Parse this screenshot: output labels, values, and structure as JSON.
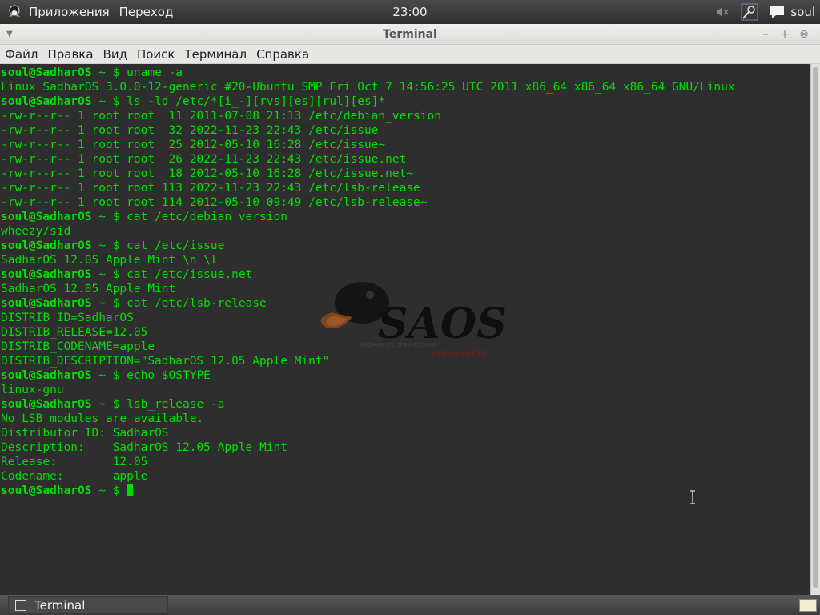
{
  "top_panel": {
    "menu_apps": "Приложения",
    "menu_places": "Переход",
    "clock": "23:00",
    "user": "soul"
  },
  "window": {
    "title": "Terminal",
    "buttons": {
      "minimize": "–",
      "maximize": "+",
      "close": "⊗"
    }
  },
  "menubar": [
    "Файл",
    "Правка",
    "Вид",
    "Поиск",
    "Терминал",
    "Справка"
  ],
  "terminal": {
    "prompt_user": "soul@SadharOS",
    "prompt_rest": " ~ $ ",
    "lines": [
      {
        "type": "cmd",
        "text": "uname -a"
      },
      {
        "type": "out",
        "text": "Linux SadharOS 3.0.0-12-generic #20-Ubuntu SMP Fri Oct 7 14:56:25 UTC 2011 x86_64 x86_64 x86_64 GNU/Linux"
      },
      {
        "type": "cmd",
        "text": "ls -ld /etc/*[i_-][rvs][es][rul][es]*"
      },
      {
        "type": "out",
        "text": "-rw-r--r-- 1 root root  11 2011-07-08 21:13 /etc/debian_version"
      },
      {
        "type": "out",
        "text": "-rw-r--r-- 1 root root  32 2022-11-23 22:43 /etc/issue"
      },
      {
        "type": "out",
        "text": "-rw-r--r-- 1 root root  25 2012-05-10 16:28 /etc/issue~"
      },
      {
        "type": "out",
        "text": "-rw-r--r-- 1 root root  26 2022-11-23 22:43 /etc/issue.net"
      },
      {
        "type": "out",
        "text": "-rw-r--r-- 1 root root  18 2012-05-10 16:28 /etc/issue.net~"
      },
      {
        "type": "out",
        "text": "-rw-r--r-- 1 root root 113 2022-11-23 22:43 /etc/lsb-release"
      },
      {
        "type": "out",
        "text": "-rw-r--r-- 1 root root 114 2012-05-10 09:49 /etc/lsb-release~"
      },
      {
        "type": "cmd",
        "text": "cat /etc/debian_version"
      },
      {
        "type": "out",
        "text": "wheezy/sid"
      },
      {
        "type": "cmd",
        "text": "cat /etc/issue"
      },
      {
        "type": "out",
        "text": "SadharOS 12.05 Apple Mint \\n \\l"
      },
      {
        "type": "cmd",
        "text": "cat /etc/issue.net"
      },
      {
        "type": "out",
        "text": "SadharOS 12.05 Apple Mint"
      },
      {
        "type": "cmd",
        "text": "cat /etc/lsb-release"
      },
      {
        "type": "out",
        "text": "DISTRIB_ID=SadharOS"
      },
      {
        "type": "out",
        "text": "DISTRIB_RELEASE=12.05"
      },
      {
        "type": "out",
        "text": "DISTRIB_CODENAME=apple"
      },
      {
        "type": "out",
        "text": "DISTRIB_DESCRIPTION=\"SadharOS 12.05 Apple Mint\""
      },
      {
        "type": "cmd",
        "text": "echo $OSTYPE"
      },
      {
        "type": "out",
        "text": "linux-gnu"
      },
      {
        "type": "cmd",
        "text": "lsb_release -a"
      },
      {
        "type": "out",
        "text": "No LSB modules are available."
      },
      {
        "type": "out",
        "text": "Distributor ID:\tSadharOS"
      },
      {
        "type": "out",
        "text": "Description:\tSadharOS 12.05 Apple Mint"
      },
      {
        "type": "out",
        "text": "Release:\t12.05"
      },
      {
        "type": "out",
        "text": "Codename:\tapple"
      },
      {
        "type": "prompt",
        "text": ""
      }
    ]
  },
  "watermark": {
    "main": "SAOS",
    "tagline": "SADHAR OS OPEN SOURCE",
    "sub": "community"
  },
  "taskbar": {
    "task_label": "Terminal"
  },
  "colors": {
    "terminal_bg": "#2e2e2e",
    "terminal_fg": "#00e000"
  }
}
